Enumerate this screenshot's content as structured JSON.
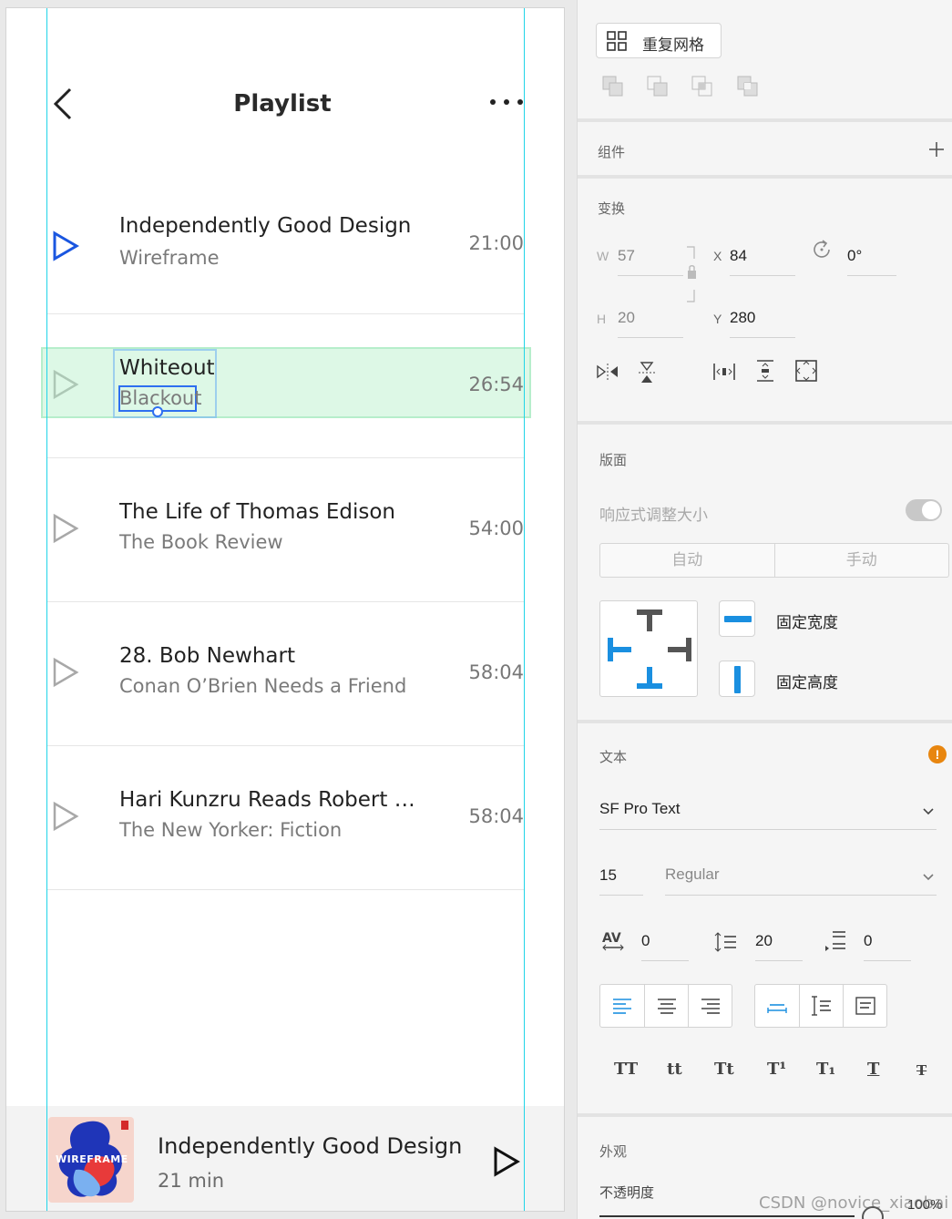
{
  "artboard": {
    "nav": {
      "title": "Playlist"
    },
    "rows": [
      {
        "title": "Independently Good Design",
        "subtitle": "Wireframe",
        "duration": "21:00",
        "active": true
      },
      {
        "title": "Whiteout",
        "subtitle": "Blackout",
        "duration": "26:54",
        "active": false
      },
      {
        "title": "The Life of Thomas Edison",
        "subtitle": "The Book Review",
        "duration": "54:00",
        "active": false
      },
      {
        "title": "28. Bob Newhart",
        "subtitle": "Conan O’Brien Needs a Friend",
        "duration": "58:04",
        "active": false
      },
      {
        "title": "Hari Kunzru Reads Robert …",
        "subtitle": "The New Yorker: Fiction",
        "duration": "58:04",
        "active": false
      }
    ],
    "mini_player": {
      "title": "Independently Good Design",
      "subtitle": "21 min",
      "art_text": "WIREFRAME"
    }
  },
  "panel": {
    "repeat_grid": "重复网格",
    "components_label": "组件",
    "transform": {
      "label": "变换",
      "w_label": "W",
      "w": "57",
      "x_label": "X",
      "x": "84",
      "h_label": "H",
      "h": "20",
      "y_label": "Y",
      "y": "280",
      "rotation": "0°"
    },
    "layout": {
      "label": "版面",
      "responsive_resize": "响应式调整大小",
      "auto": "自动",
      "manual": "手动",
      "fixed_width": "固定宽度",
      "fixed_height": "固定高度"
    },
    "text": {
      "label": "文本",
      "warning": "!",
      "font_family": "SF Pro Text",
      "font_size": "15",
      "font_weight": "Regular",
      "char_spacing": "0",
      "line_spacing": "20",
      "paragraph_spacing": "0",
      "transform_buttons": [
        "TT",
        "tt",
        "Tt",
        "T¹",
        "T₁",
        "T",
        "T"
      ]
    },
    "appearance": {
      "label": "外观",
      "opacity_label": "不透明度",
      "opacity": "100%"
    }
  },
  "watermark": "CSDN @novice_xiaobai",
  "colors": {
    "accent": "#1a8fe0",
    "play_active": "#1a56e0",
    "guide": "#20d4e8"
  }
}
